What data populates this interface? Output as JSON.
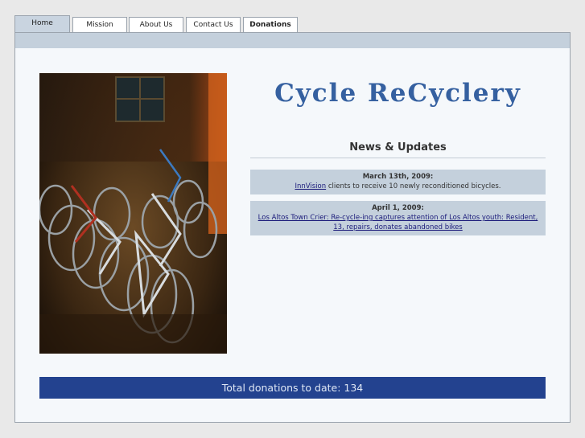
{
  "nav": {
    "tabs": [
      {
        "label": "Home",
        "active": true
      },
      {
        "label": "Mission"
      },
      {
        "label": "About Us"
      },
      {
        "label": "Contact Us"
      },
      {
        "label": "Donations"
      }
    ]
  },
  "site": {
    "logo_text": "Cycle ReCyclery"
  },
  "news": {
    "title": "News & Updates",
    "items": [
      {
        "date": "March 13th, 2009:",
        "link_text": "InnVision",
        "text": " clients to receive 10 newly reconditioned bicycles."
      },
      {
        "date": "April 1, 2009:",
        "link_text": "Los Altos Town Crier: Re-cycle-ing captures attention of Los Altos youth: Resident, 13, repairs, donates abandoned bikes"
      }
    ]
  },
  "donations": {
    "text": "Total donations to date: 134"
  },
  "colors": {
    "accent": "#23428f",
    "band": "#c4d0dc",
    "logo": "#3560a0"
  }
}
